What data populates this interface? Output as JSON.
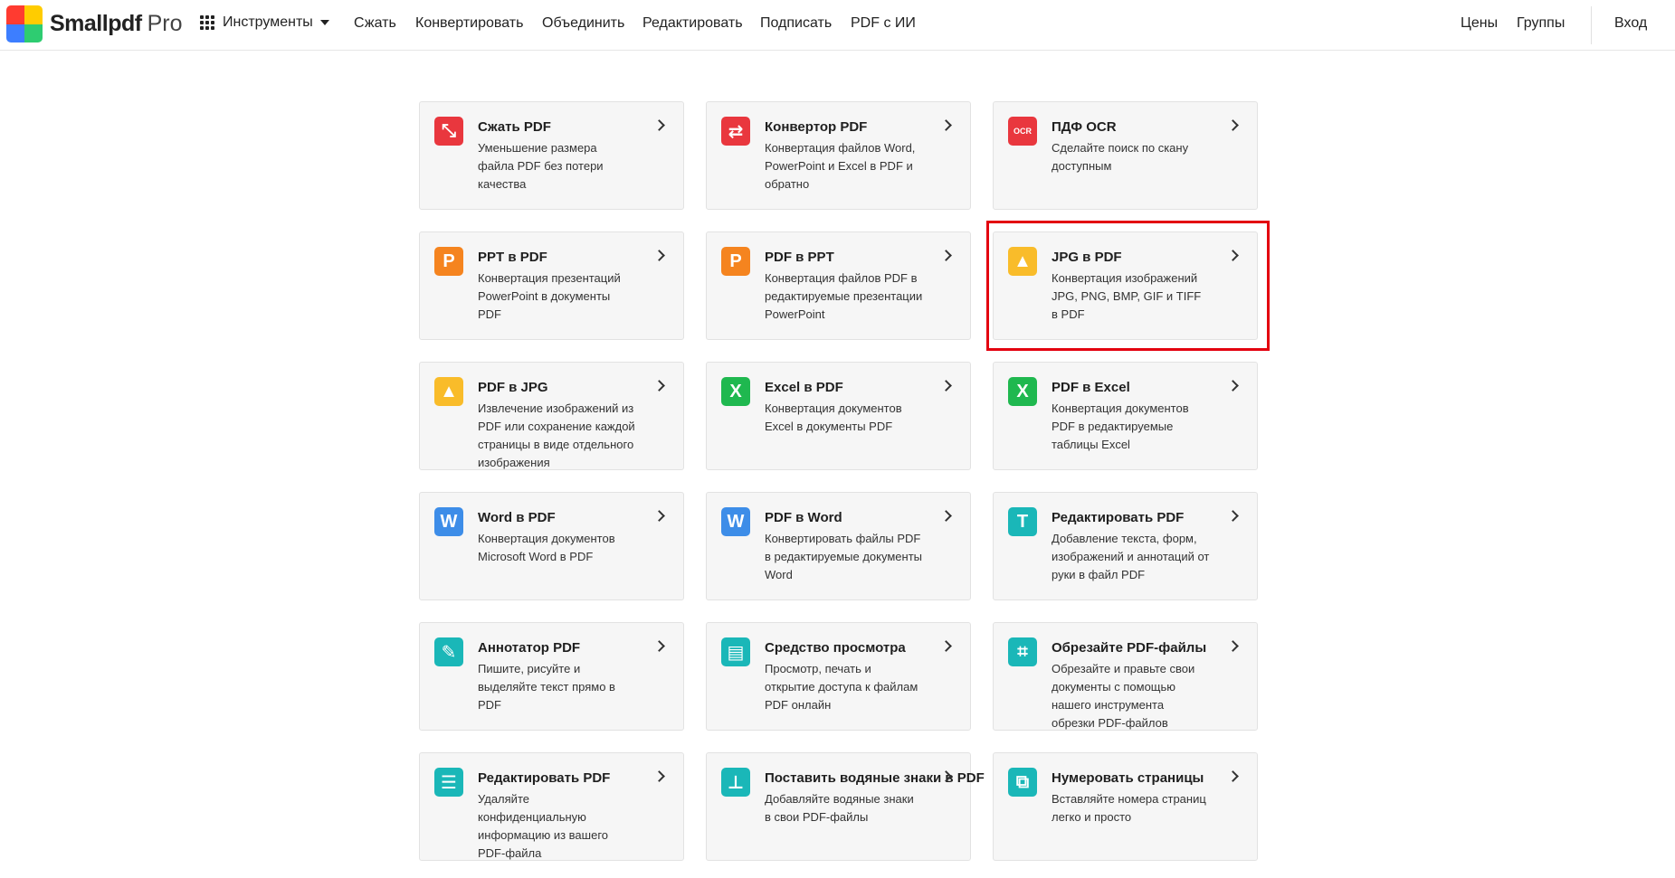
{
  "header": {
    "logo_text": "Smallpdf",
    "logo_pro": "Pro",
    "tools_label": "Инструменты",
    "nav": [
      "Сжать",
      "Конвертировать",
      "Объединить",
      "Редактировать",
      "Подписать",
      "PDF с ИИ"
    ],
    "right_nav": [
      "Цены",
      "Группы"
    ],
    "login": "Вход"
  },
  "logo_colors": [
    "#ff3b30",
    "#ffcc00",
    "#2ecc71",
    "#3d7eff",
    "#a05cff",
    "#ff4fa0"
  ],
  "tools": [
    {
      "title": "Сжать PDF",
      "desc": "Уменьшение размера файла PDF без потери качества",
      "icon": "compress-icon",
      "color": "#e9373e",
      "glyph": "⤡"
    },
    {
      "title": "Конвертор PDF",
      "desc": "Конвертация файлов Word, PowerPoint и Excel в PDF и обратно",
      "icon": "convert-icon",
      "color": "#e9373e",
      "glyph": "⇄"
    },
    {
      "title": "ПДФ OCR",
      "desc": "Сделайте поиск по скану доступным",
      "icon": "ocr-icon",
      "color": "#e9373e",
      "glyph": "OCR"
    },
    {
      "title": "PPT в PDF",
      "desc": "Конвертация презентаций PowerPoint в документы PDF",
      "icon": "powerpoint-icon",
      "color": "#f5841f",
      "glyph": "P"
    },
    {
      "title": "PDF в PPT",
      "desc": "Конвертация файлов PDF в редактируемые презентации PowerPoint",
      "icon": "powerpoint-icon",
      "color": "#f5841f",
      "glyph": "P"
    },
    {
      "title": "JPG в PDF",
      "desc": "Конвертация изображений JPG, PNG, BMP, GIF и TIFF в PDF",
      "icon": "image-icon",
      "color": "#f9bc2a",
      "glyph": "▲"
    },
    {
      "title": "PDF в JPG",
      "desc": "Извлечение изображений из PDF или сохранение каждой страницы в виде отдельного изображения",
      "icon": "image-icon",
      "color": "#f9bc2a",
      "glyph": "▲"
    },
    {
      "title": "Excel в PDF",
      "desc": "Конвертация документов Excel в документы PDF",
      "icon": "excel-icon",
      "color": "#1fb84f",
      "glyph": "X"
    },
    {
      "title": "PDF в Excel",
      "desc": "Конвертация документов PDF в редактируемые таблицы Excel",
      "icon": "excel-icon",
      "color": "#1fb84f",
      "glyph": "X"
    },
    {
      "title": "Word в PDF",
      "desc": "Конвертация документов Microsoft Word в PDF",
      "icon": "word-icon",
      "color": "#3d8de8",
      "glyph": "W"
    },
    {
      "title": "PDF в Word",
      "desc": "Конвертировать файлы PDF в редактируемые документы Word",
      "icon": "word-icon",
      "color": "#3d8de8",
      "glyph": "W"
    },
    {
      "title": "Редактировать PDF",
      "desc": "Добавление текста, форм, изображений и аннотаций от руки в файл PDF",
      "icon": "text-edit-icon",
      "color": "#1ab7b8",
      "glyph": "T"
    },
    {
      "title": "Аннотатор PDF",
      "desc": "Пишите, рисуйте и выделяйте текст прямо в PDF",
      "icon": "pencil-icon",
      "color": "#1ab7b8",
      "glyph": "✎"
    },
    {
      "title": "Средство просмотра",
      "desc": "Просмотр, печать и открытие доступа к файлам PDF онлайн",
      "icon": "document-icon",
      "color": "#1ab7b8",
      "glyph": "▤"
    },
    {
      "title": "Обрезайте PDF-файлы",
      "desc": "Обрезайте и правьте свои документы с помощью нашего инструмента обрезки PDF-файлов",
      "icon": "crop-icon",
      "color": "#1ab7b8",
      "glyph": "⌗"
    },
    {
      "title": "Редактировать PDF",
      "desc": "Удаляйте конфиденциальную информацию из вашего PDF-файла",
      "icon": "redact-icon",
      "color": "#1ab7b8",
      "glyph": "☰"
    },
    {
      "title": "Поставить водяные знаки в PDF",
      "desc": "Добавляйте водяные знаки в свои PDF-файлы",
      "icon": "stamp-icon",
      "color": "#1ab7b8",
      "glyph": "⊥"
    },
    {
      "title": "Нумеровать страницы",
      "desc": "Вставляйте номера страниц легко и просто",
      "icon": "page-numbers-icon",
      "color": "#1ab7b8",
      "glyph": "⧉"
    }
  ]
}
